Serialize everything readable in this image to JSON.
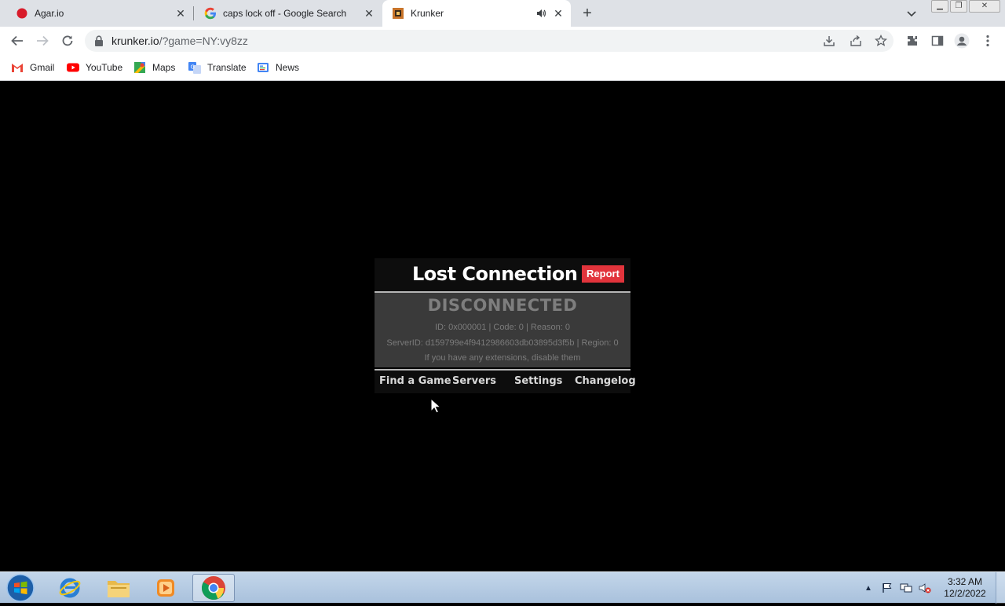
{
  "browser": {
    "tabs": [
      {
        "title": "Agar.io",
        "favicon": "agar-icon",
        "active": false
      },
      {
        "title": "caps lock off - Google Search",
        "favicon": "google-icon",
        "active": false
      },
      {
        "title": "Krunker",
        "favicon": "krunker-icon",
        "active": true,
        "audio": true
      }
    ],
    "new_tab": "+",
    "url_host": "krunker.io",
    "url_path": "/?game=NY:vy8zz",
    "bookmarks": [
      {
        "label": "Gmail",
        "icon": "gmail-icon"
      },
      {
        "label": "YouTube",
        "icon": "youtube-icon"
      },
      {
        "label": "Maps",
        "icon": "maps-icon"
      },
      {
        "label": "Translate",
        "icon": "translate-icon"
      },
      {
        "label": "News",
        "icon": "news-icon"
      }
    ]
  },
  "dialog": {
    "title": "Lost Connection",
    "report_label": "Report",
    "status": "DISCONNECTED",
    "id_line": "ID: 0x000001 | Code: 0 | Reason: 0",
    "server_line": "ServerID: d159799e4f9412986603db03895d3f5b | Region: 0",
    "hint": "If you have any extensions, disable them",
    "links": [
      "Find a Game",
      "Servers",
      "Settings",
      "Changelog"
    ]
  },
  "taskbar": {
    "apps": [
      "internet-explorer-icon",
      "file-explorer-icon",
      "media-player-icon",
      "chrome-icon"
    ],
    "time": "3:32 AM",
    "date": "12/2/2022"
  },
  "colors": {
    "report_red": "#e2343c",
    "dialog_body": "#3a3a3a",
    "taskbar": "#b6cbe3"
  }
}
